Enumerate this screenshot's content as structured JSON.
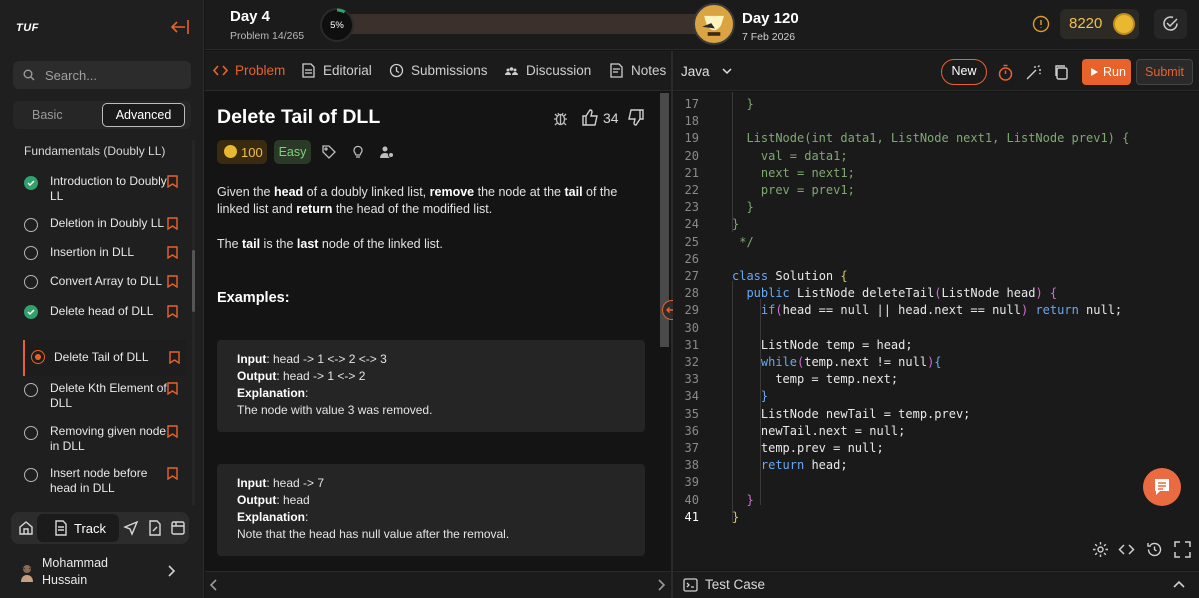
{
  "app": {
    "logo": "TUF",
    "accent": "#e8622c"
  },
  "sidebar": {
    "search_placeholder": "Search...",
    "modes": {
      "basic": "Basic",
      "advanced": "Advanced",
      "active": "Advanced"
    },
    "section_title": "Fundamentals (Doubly LL)",
    "lessons": [
      {
        "label": "Introduction to Doubly LL",
        "status": "done"
      },
      {
        "label": "Deletion in Doubly LL",
        "status": "todo"
      },
      {
        "label": "Insertion in DLL",
        "status": "todo"
      },
      {
        "label": "Convert Array to DLL",
        "status": "todo"
      },
      {
        "label": "Delete head of DLL",
        "status": "done"
      },
      {
        "label": "Delete Tail of DLL",
        "status": "current"
      },
      {
        "label": "Delete Kth Element of DLL",
        "status": "todo"
      },
      {
        "label": "Removing given node in DLL",
        "status": "todo"
      },
      {
        "label": "Insert node before head in DLL",
        "status": "todo"
      }
    ],
    "dock": {
      "track_label": "Track"
    },
    "user": {
      "name": "Mohammad Hussain"
    }
  },
  "topbar": {
    "day_current": "Day 4",
    "problem_count": "Problem 14/265",
    "progress_label": "5%",
    "progress": 0.05,
    "day_goal": "Day 120",
    "goal_date": "7 Feb 2026",
    "coins": "8220"
  },
  "tabs": [
    "Problem",
    "Editorial",
    "Submissions",
    "Discussion",
    "Notes"
  ],
  "problem": {
    "title": "Delete Tail of DLL",
    "likes": "34",
    "coins": "100",
    "difficulty": "Easy",
    "desc1": {
      "p1": "Given the ",
      "b1": "head",
      "p2": " of a doubly linked list, ",
      "b2": "remove",
      "p3": " the node at the ",
      "b3": "tail",
      "p4": " of the linked list and ",
      "b4": "return",
      "p5": " the head of the modified list."
    },
    "desc2": {
      "p1": "The ",
      "b1": "tail",
      "p2": " is the ",
      "b2": "last",
      "p3": " node of the linked list."
    },
    "examples_heading": "Examples:",
    "labels": {
      "input": "Input",
      "output": "Output",
      "explanation": "Explanation"
    },
    "examples": [
      {
        "input": ": head -> 1 <-> 2 <-> 3",
        "output": ": head -> 1 <-> 2",
        "explanation": "The node with value 3 was removed."
      },
      {
        "input": ": head -> 7",
        "output": ": head",
        "explanation": "Note that the head has null value after the removal."
      }
    ]
  },
  "editor": {
    "language": "Java",
    "new_label": "New",
    "run_label": "Run",
    "submit_label": "Submit",
    "lines": [
      {
        "n": "17",
        "i": 2,
        "s": [
          [
            "}",
            "c-com"
          ]
        ]
      },
      {
        "n": "18",
        "i": 0,
        "s": []
      },
      {
        "n": "19",
        "i": 2,
        "s": [
          [
            "ListNode(int data1, ListNode next1, ListNode prev1) {",
            "c-com"
          ]
        ]
      },
      {
        "n": "20",
        "i": 4,
        "s": [
          [
            "val = data1;",
            "c-com"
          ]
        ]
      },
      {
        "n": "21",
        "i": 4,
        "s": [
          [
            "next = next1;",
            "c-com"
          ]
        ]
      },
      {
        "n": "22",
        "i": 4,
        "s": [
          [
            "prev = prev1;",
            "c-com"
          ]
        ]
      },
      {
        "n": "23",
        "i": 2,
        "s": [
          [
            "}",
            "c-com"
          ]
        ]
      },
      {
        "n": "24",
        "i": 0,
        "s": [
          [
            "}",
            "c-com"
          ]
        ]
      },
      {
        "n": "25",
        "i": 0,
        "s": [
          [
            " */",
            "c-com"
          ]
        ]
      },
      {
        "n": "26",
        "i": 0,
        "s": []
      },
      {
        "n": "27",
        "i": 0,
        "s": [
          [
            "class",
            "c-kw"
          ],
          [
            " Solution ",
            ""
          ],
          [
            "{",
            "c-cls"
          ]
        ]
      },
      {
        "n": "28",
        "i": 2,
        "s": [
          [
            "public",
            "c-kw"
          ],
          [
            " ListNode deleteTail",
            ""
          ],
          [
            "(",
            "c-br"
          ],
          [
            "ListNode head",
            ""
          ],
          [
            ")",
            "c-br"
          ],
          [
            " ",
            ""
          ],
          [
            "{",
            "c-br"
          ]
        ]
      },
      {
        "n": "29",
        "i": 4,
        "s": [
          [
            "if",
            "c-kw"
          ],
          [
            "(",
            "c-br"
          ],
          [
            "head == null || head.next == null",
            ""
          ],
          [
            ")",
            "c-br"
          ],
          [
            " ",
            ""
          ],
          [
            "return",
            "c-kw"
          ],
          [
            " null;",
            ""
          ]
        ]
      },
      {
        "n": "30",
        "i": 0,
        "s": []
      },
      {
        "n": "31",
        "i": 4,
        "s": [
          [
            "ListNode temp = head;",
            ""
          ]
        ]
      },
      {
        "n": "32",
        "i": 4,
        "s": [
          [
            "while",
            "c-kw"
          ],
          [
            "(",
            "c-br"
          ],
          [
            "temp.next != null",
            ""
          ],
          [
            ")",
            "c-br"
          ],
          [
            "{",
            "c-kw"
          ]
        ]
      },
      {
        "n": "33",
        "i": 6,
        "s": [
          [
            "temp = temp.next;",
            ""
          ]
        ]
      },
      {
        "n": "34",
        "i": 4,
        "s": [
          [
            "}",
            "c-kw"
          ]
        ]
      },
      {
        "n": "35",
        "i": 4,
        "s": [
          [
            "ListNode newTail = temp.prev;",
            ""
          ]
        ]
      },
      {
        "n": "36",
        "i": 4,
        "s": [
          [
            "newTail.next = null;",
            ""
          ]
        ]
      },
      {
        "n": "37",
        "i": 4,
        "s": [
          [
            "temp.prev = null;",
            ""
          ]
        ]
      },
      {
        "n": "38",
        "i": 4,
        "s": [
          [
            "return",
            "c-kw"
          ],
          [
            " head;",
            ""
          ]
        ]
      },
      {
        "n": "39",
        "i": 0,
        "s": []
      },
      {
        "n": "40",
        "i": 2,
        "s": [
          [
            "}",
            "c-br"
          ]
        ]
      },
      {
        "n": "41",
        "i": 0,
        "s": [
          [
            "}",
            "c-cls"
          ]
        ]
      }
    ],
    "current_line": "41"
  },
  "testcase": {
    "label": "Test Case"
  }
}
